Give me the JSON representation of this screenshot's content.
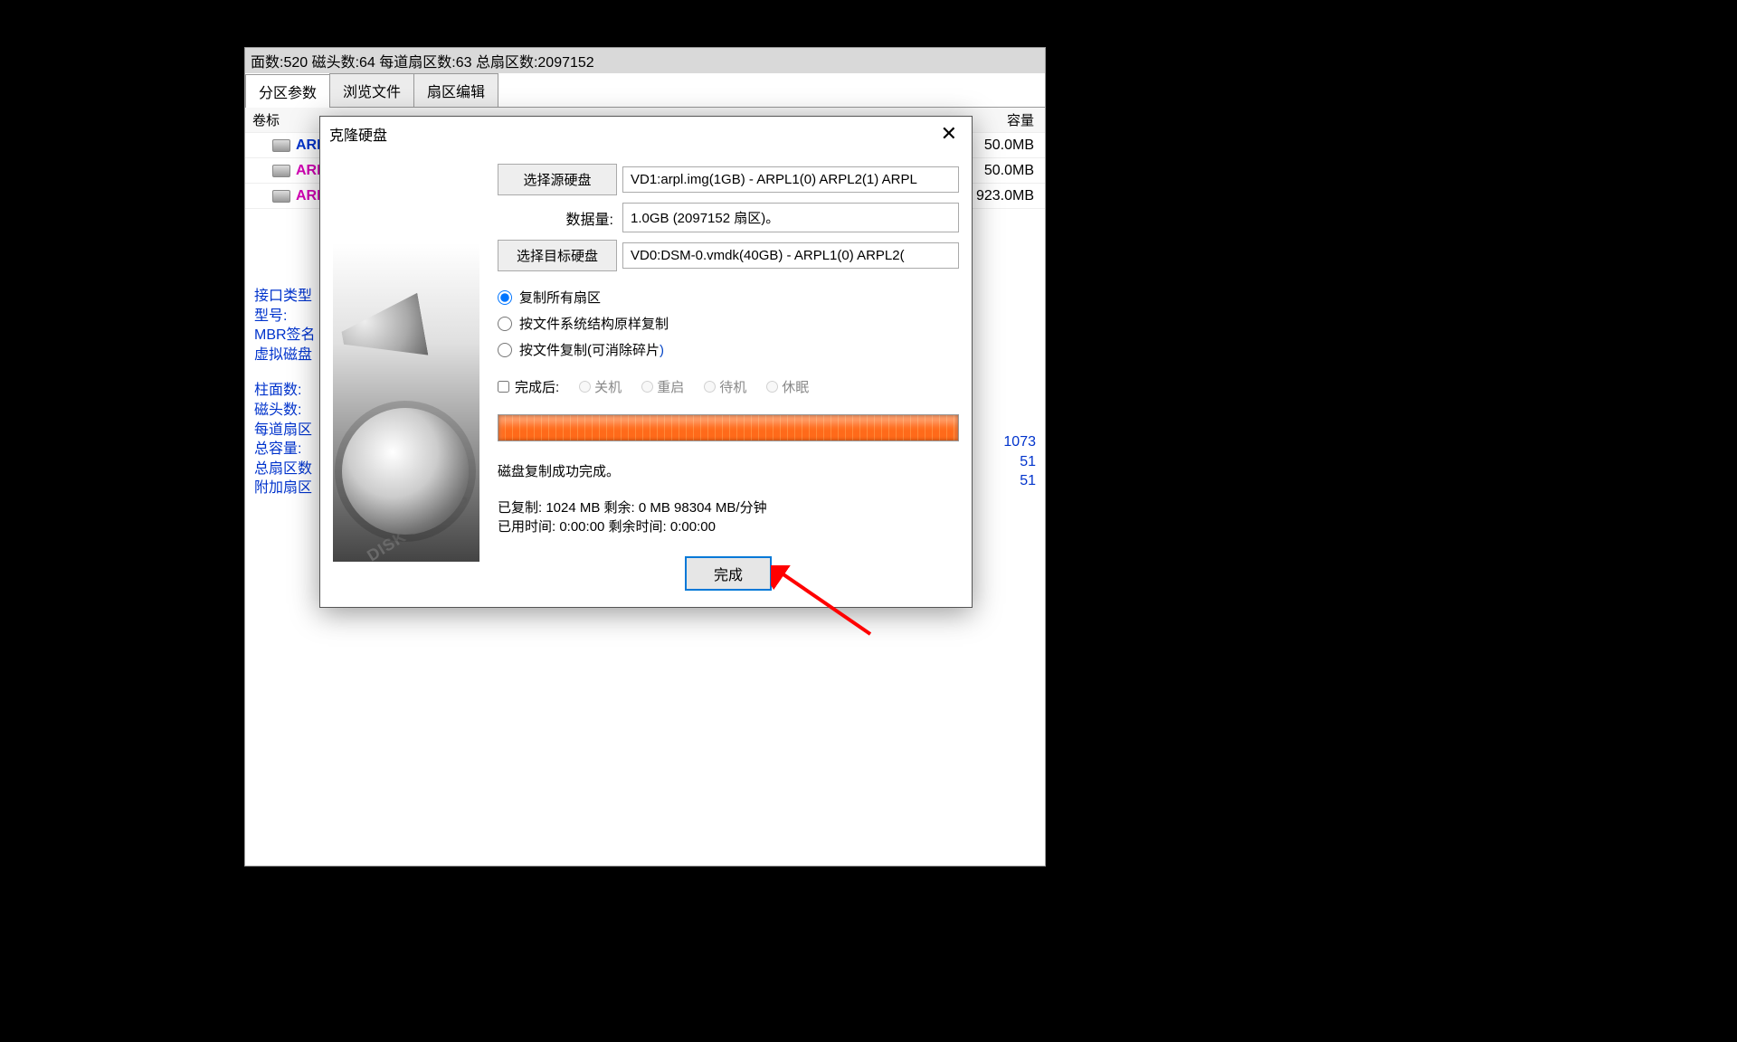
{
  "topbar": "面数:520 磁头数:64 每道扇区数:63 总扇区数:2097152",
  "tabs": {
    "t0": "分区参数",
    "t1": "浏览文件",
    "t2": "扇区编辑"
  },
  "header": {
    "label": "卷标",
    "capacity": "容量"
  },
  "partitions": [
    {
      "name": "ARPL",
      "cap": "50.0MB",
      "color": "#0033cc"
    },
    {
      "name": "ARPL",
      "cap": "50.0MB",
      "color": "#d400b5"
    },
    {
      "name": "ARPL",
      "cap": "923.0MB",
      "color": "#d400b5"
    }
  ],
  "info1": [
    "接口类型",
    "型号:",
    "MBR签名",
    "虚拟磁盘"
  ],
  "info2": [
    "柱面数:",
    "磁头数:",
    "每道扇区",
    "总容量:",
    "总扇区数",
    "附加扇区"
  ],
  "rightNums": [
    "1073",
    "51",
    "51"
  ],
  "dialog": {
    "title": "克隆硬盘",
    "srcBtn": "选择源硬盘",
    "srcVal": "VD1:arpl.img(1GB) - ARPL1(0) ARPL2(1) ARPL",
    "dataLabel": "数据量:",
    "dataVal": "1.0GB (2097152 扇区)。",
    "dstBtn": "选择目标硬盘",
    "dstVal": "VD0:DSM-0.vmdk(40GB) - ARPL1(0) ARPL2(",
    "radio": {
      "r1": "复制所有扇区",
      "r2": "按文件系统结构原样复制",
      "r3a": "按文件复制(可消除碎片",
      "r3b": ")"
    },
    "afterChk": "完成后:",
    "afterOpts": {
      "o1": "关机",
      "o2": "重启",
      "o3": "待机",
      "o4": "休眠"
    },
    "statusDone": "磁盘复制成功完成。",
    "stats1": "已复制:   1024 MB  剩余:      0 MB  98304 MB/分钟",
    "stats2": "已用时间: 0:00:00  剩余时间: 0:00:00",
    "finish": "完成",
    "brand": "DISK GENIUS"
  }
}
